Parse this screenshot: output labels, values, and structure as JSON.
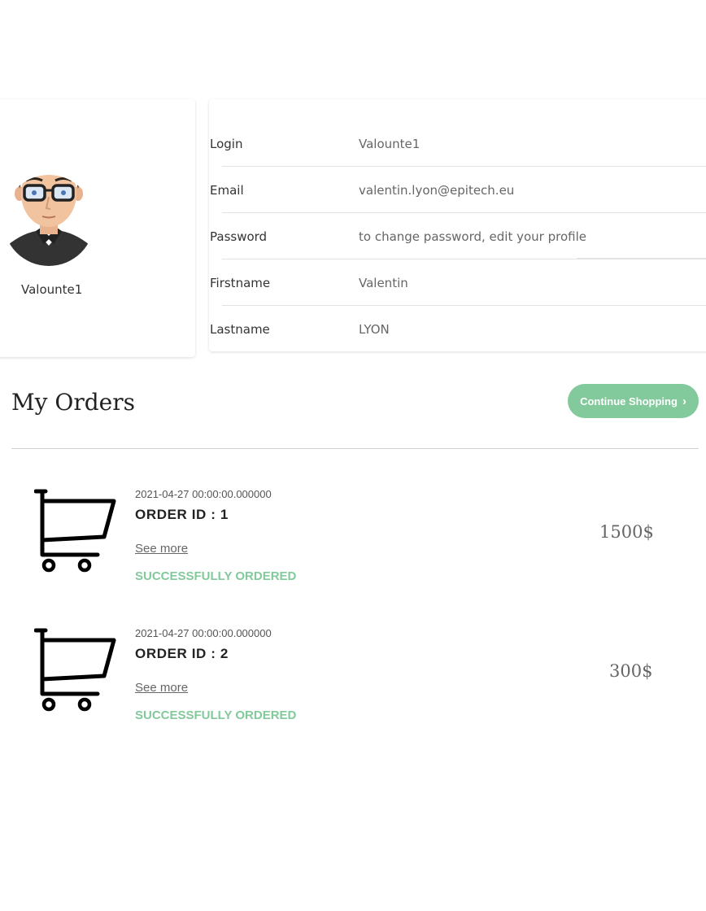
{
  "profile": {
    "username": "Valounte1"
  },
  "info": {
    "rows": [
      {
        "label": "Login",
        "value": "Valounte1"
      },
      {
        "label": "Email",
        "value": "valentin.lyon@epitech.eu"
      },
      {
        "label": "Password",
        "value": "to change password, edit your profile"
      },
      {
        "label": "Firstname",
        "value": "Valentin"
      },
      {
        "label": "Lastname",
        "value": "LYON"
      }
    ]
  },
  "orders": {
    "title": "My Orders",
    "continue_label": "Continue Shopping",
    "items": [
      {
        "date": "2021-04-27 00:00:00.000000",
        "order_id": "ORDER ID : 1",
        "see_more": "See more",
        "status": "SUCCESSFULLY ORDERED",
        "price": "1500$"
      },
      {
        "date": "2021-04-27 00:00:00.000000",
        "order_id": "ORDER ID : 2",
        "see_more": "See more",
        "status": "SUCCESSFULLY ORDERED",
        "price": "300$"
      }
    ]
  },
  "colors": {
    "accent": "#82c99b",
    "text_dark": "#222222",
    "text_muted": "#666666"
  },
  "icons": {
    "avatar": "user-avatar-illustration",
    "cart": "shopping-cart-icon",
    "continue": "chevron-right-icon"
  }
}
